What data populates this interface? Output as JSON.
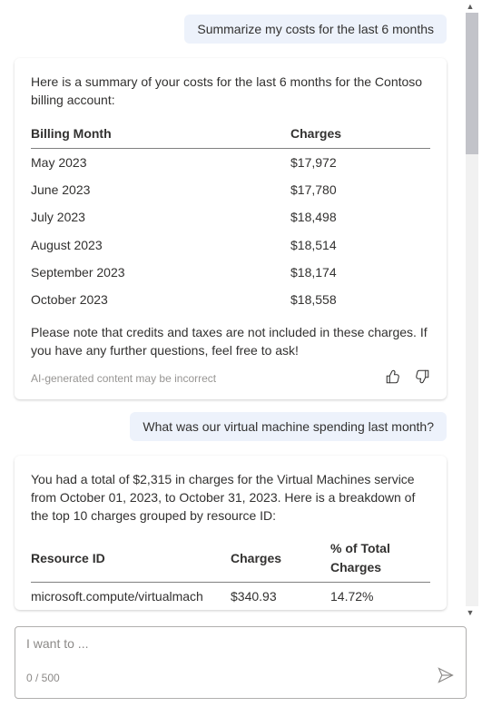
{
  "messages": {
    "user1": "Summarize my costs for the last 6 months",
    "assistant1_intro": "Here is a summary of your costs for the last 6 months for the Contoso billing account:",
    "assistant1_outro": "Please note that credits and taxes are not included in these charges. If you have any further questions, feel free to ask!",
    "user2": "What was our virtual machine spending last month?",
    "assistant2_intro": "You had a total of $2,315 in charges for the Virtual Machines service from October 01, 2023, to October 31, 2023. Here is a breakdown of the top 10 charges grouped by resource ID:"
  },
  "table_costs": {
    "headers": {
      "month": "Billing Month",
      "charges": "Charges"
    },
    "rows": [
      {
        "month": "May 2023",
        "charges": "$17,972"
      },
      {
        "month": "June 2023",
        "charges": "$17,780"
      },
      {
        "month": "July 2023",
        "charges": "$18,498"
      },
      {
        "month": "August 2023",
        "charges": "$18,514"
      },
      {
        "month": "September 2023",
        "charges": "$18,174"
      },
      {
        "month": "October 2023",
        "charges": "$18,558"
      }
    ]
  },
  "table_vm": {
    "headers": {
      "resource": "Resource ID",
      "charges": "Charges",
      "pct": "% of Total Charges"
    },
    "rows": [
      {
        "resource": "microsoft.compute/virtualmach",
        "charges": "$340.93",
        "pct": "14.72%"
      }
    ]
  },
  "disclaimer": "AI-generated content may be incorrect",
  "input": {
    "placeholder": "I want to ...",
    "char_count": "0 / 500"
  }
}
